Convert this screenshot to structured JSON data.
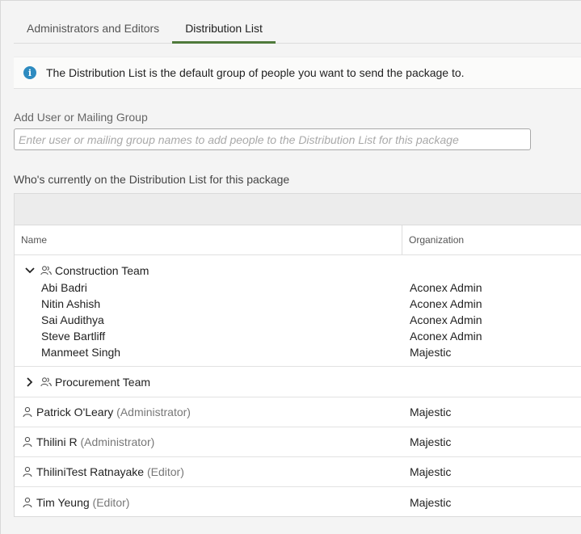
{
  "tabs": [
    {
      "label": "Administrators and Editors",
      "active": false
    },
    {
      "label": "Distribution List",
      "active": true
    }
  ],
  "info": {
    "icon": "info-icon",
    "text": "The Distribution List is the default group of people you want to send the package to."
  },
  "add_user": {
    "label": "Add User or Mailing Group",
    "placeholder": "Enter user or mailing group names to add people to the Distribution List for this package",
    "value": ""
  },
  "list_label": "Who's currently on the Distribution List for this package",
  "table": {
    "columns": {
      "name": "Name",
      "organization": "Organization"
    },
    "groups": [
      {
        "name": "Construction Team",
        "expanded": true,
        "members": [
          {
            "name": "Abi Badri",
            "organization": "Aconex Admin"
          },
          {
            "name": "Nitin Ashish",
            "organization": "Aconex Admin"
          },
          {
            "name": "Sai Audithya",
            "organization": "Aconex Admin"
          },
          {
            "name": "Steve Bartliff",
            "organization": "Aconex Admin"
          },
          {
            "name": "Manmeet Singh",
            "organization": "Majestic"
          }
        ]
      },
      {
        "name": "Procurement Team",
        "expanded": false
      }
    ],
    "users": [
      {
        "name": "Patrick O'Leary",
        "role": "(Administrator)",
        "organization": "Majestic"
      },
      {
        "name": "Thilini R",
        "role": "(Administrator)",
        "organization": "Majestic"
      },
      {
        "name": "ThiliniTest Ratnayake",
        "role": "(Editor)",
        "organization": "Majestic"
      },
      {
        "name": "Tim Yeung",
        "role": "(Editor)",
        "organization": "Majestic"
      }
    ]
  },
  "colors": {
    "accent": "#4f7a3b",
    "info": "#2e8bc0"
  }
}
